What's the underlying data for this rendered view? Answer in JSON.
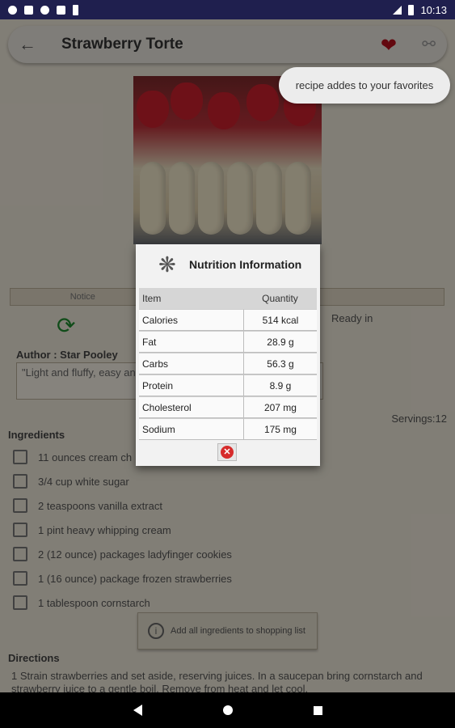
{
  "status_bar": {
    "time": "10:13"
  },
  "app_bar": {
    "title": "Strawberry Torte",
    "back_icon": "arrow-back-icon",
    "favorite_icon": "heart-icon",
    "share_icon": "share-icon"
  },
  "toast": {
    "text": "recipe addes to your favorites"
  },
  "recipe": {
    "tab_left": "Notice",
    "ready_label": "Ready in",
    "author": "Author : Star Pooley",
    "description": "\"Light and fluffy, easy an",
    "servings": "Servings:12",
    "ingredients_title": "Ingredients",
    "ingredients": [
      "11 ounces cream ch",
      "3/4 cup white sugar",
      "2 teaspoons vanilla extract",
      "1 pint heavy whipping cream",
      "2 (12 ounce) packages ladyfinger cookies",
      "1 (16 ounce) package frozen strawberries",
      "1 tablespoon cornstarch"
    ],
    "shopping_button": "Add all ingredients to shopping list",
    "directions_title": "Directions",
    "directions_text": "1  Strain strawberries and set aside, reserving juices. In a saucepan bring cornstarch and strawberry juice to a gentle boil. Remove from heat and let cool."
  },
  "dialog": {
    "title": "Nutrition Information",
    "col_item": "Item",
    "col_quantity": "Quantity",
    "rows": [
      {
        "item": "Calories",
        "quantity": "514 kcal"
      },
      {
        "item": "Fat",
        "quantity": "28.9 g"
      },
      {
        "item": "Carbs",
        "quantity": "56.3 g"
      },
      {
        "item": "Protein",
        "quantity": "8.9 g"
      },
      {
        "item": "Cholesterol",
        "quantity": "207 mg"
      },
      {
        "item": "Sodium",
        "quantity": "175 mg"
      }
    ],
    "close_icon": "close-icon"
  }
}
